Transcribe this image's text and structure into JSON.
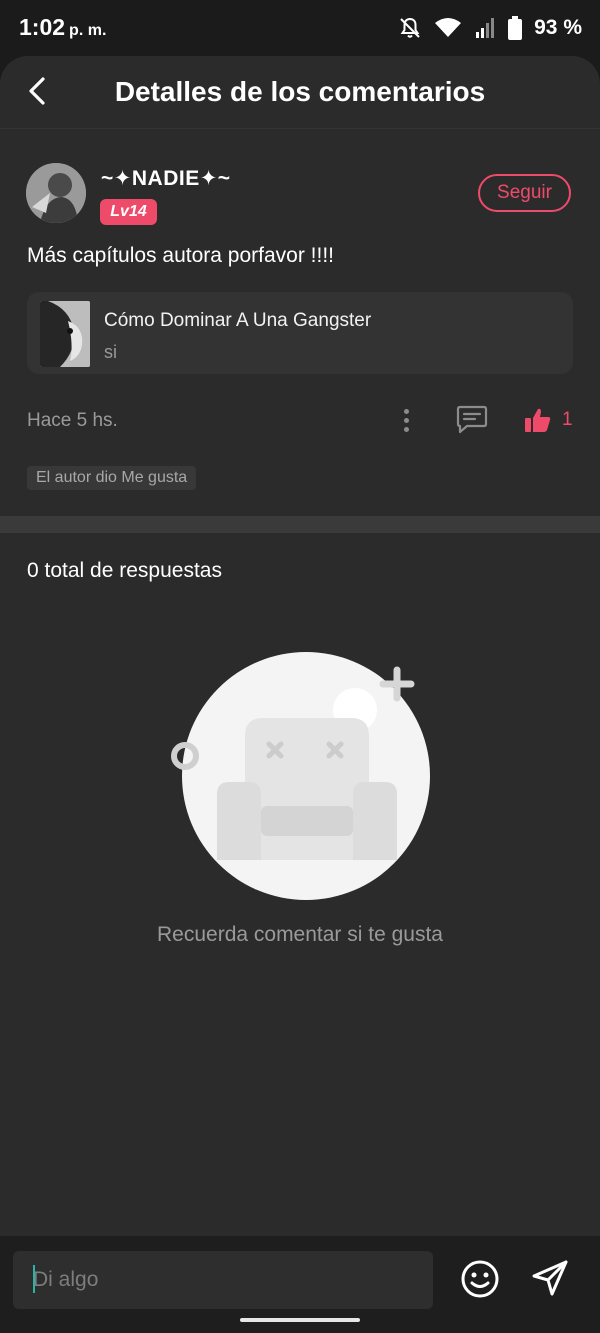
{
  "status_bar": {
    "time": "1:02",
    "ampm": "p. m.",
    "battery": "93 %"
  },
  "header": {
    "title": "Detalles de los comentarios"
  },
  "comment": {
    "username": "~✦NADIE✦~",
    "level": "Lv14",
    "follow_label": "Seguir",
    "text": "Más capítulos autora porfavor !!!!",
    "book": {
      "title": "Cómo Dominar A Una Gangster",
      "subtitle": "si"
    },
    "time_ago": "Hace 5 hs.",
    "like_count": "1",
    "author_liked": "El autor dio Me gusta"
  },
  "replies": {
    "total_label": "0 total de respuestas",
    "empty_text": "Recuerda comentar si te gusta"
  },
  "composer": {
    "placeholder": "Di algo"
  },
  "colors": {
    "accent": "#ee4b6a",
    "background": "#2b2b2b",
    "status_bar": "#1b1b1b"
  }
}
